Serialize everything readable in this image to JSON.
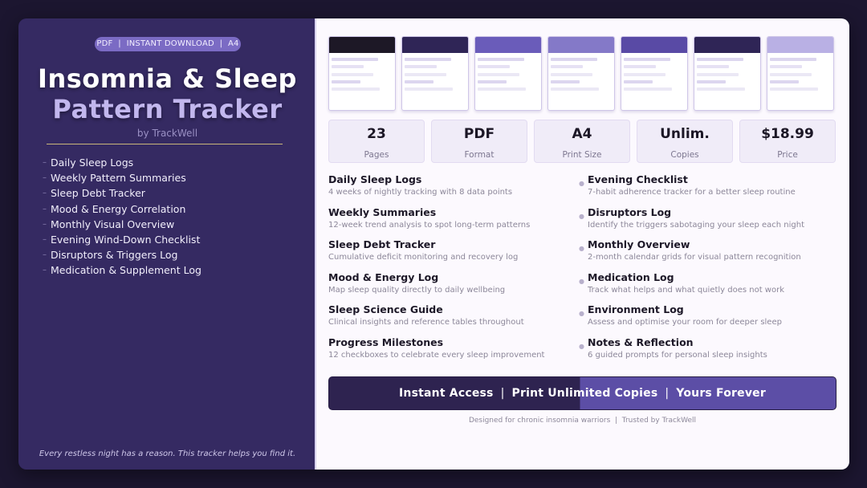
{
  "colors": {
    "background": "#1c1630",
    "left_panel": "#352a62",
    "right_panel": "#fcf9fe",
    "accent": "#7b6bc4",
    "title_highlight": "#c2b7ee",
    "cta_dark": "#2e2350",
    "cta_light": "#5c4ea6"
  },
  "badge": "PDF  |  INSTANT DOWNLOAD  |  A4",
  "title_line1": "Insomnia & Sleep",
  "title_line2": "Pattern Tracker",
  "byline": "by TrackWell",
  "left_features": [
    "Daily Sleep Logs",
    "Weekly Pattern Summaries",
    "Sleep Debt Tracker",
    "Mood & Energy Correlation",
    "Monthly Visual Overview",
    "Evening Wind-Down Checklist",
    "Disruptors & Triggers Log",
    "Medication & Supplement Log"
  ],
  "quote": "Every restless night has a reason. This tracker helps you find it.",
  "thumbnails": [
    {
      "band": "#1d1826"
    },
    {
      "band": "#2f2556"
    },
    {
      "band": "#6a5cba"
    },
    {
      "band": "#8479c8"
    },
    {
      "band": "#594aa5"
    },
    {
      "band": "#2f2556"
    },
    {
      "band": "#b9b0e4"
    }
  ],
  "stats": [
    {
      "value": "23",
      "label": "Pages"
    },
    {
      "value": "PDF",
      "label": "Format"
    },
    {
      "value": "A4",
      "label": "Print Size"
    },
    {
      "value": "Unlim.",
      "label": "Copies"
    },
    {
      "value": "$18.99",
      "label": "Price"
    }
  ],
  "features_left": [
    {
      "title": "Daily Sleep Logs",
      "desc": "4 weeks of nightly tracking with 8 data points"
    },
    {
      "title": "Weekly Summaries",
      "desc": "12-week trend analysis to spot long-term patterns"
    },
    {
      "title": "Sleep Debt Tracker",
      "desc": "Cumulative deficit monitoring and recovery log"
    },
    {
      "title": "Mood & Energy Log",
      "desc": "Map sleep quality directly to daily wellbeing"
    },
    {
      "title": "Sleep Science Guide",
      "desc": "Clinical insights and reference tables throughout"
    },
    {
      "title": "Progress Milestones",
      "desc": "12 checkboxes to celebrate every sleep improvement"
    }
  ],
  "features_right": [
    {
      "title": "Evening Checklist",
      "desc": "7-habit adherence tracker for a better sleep routine"
    },
    {
      "title": "Disruptors Log",
      "desc": "Identify the triggers sabotaging your sleep each night"
    },
    {
      "title": "Monthly Overview",
      "desc": "2-month calendar grids for visual pattern recognition"
    },
    {
      "title": "Medication Log",
      "desc": "Track what helps and what quietly does not work"
    },
    {
      "title": "Environment Log",
      "desc": "Assess and optimise your room for deeper sleep"
    },
    {
      "title": "Notes & Reflection",
      "desc": "6 guided prompts for personal sleep insights"
    }
  ],
  "cta": {
    "part1": "Instant Access",
    "part2": "Print Unlimited Copies",
    "part3": "Yours Forever",
    "sep": "|"
  },
  "footer": "Designed for chronic insomnia warriors  |  Trusted by TrackWell"
}
